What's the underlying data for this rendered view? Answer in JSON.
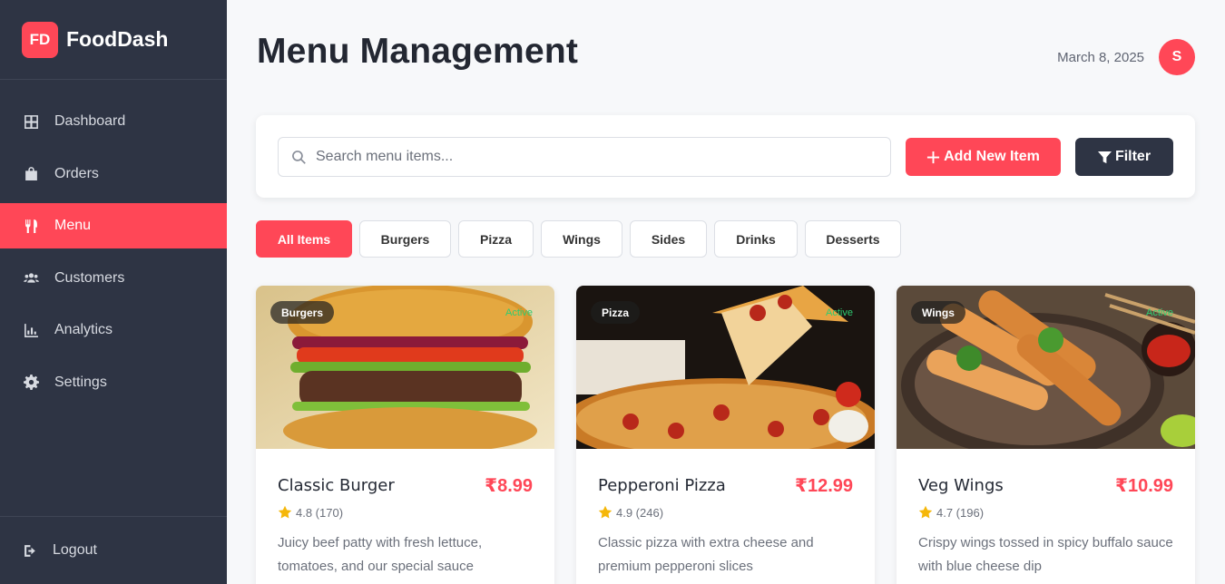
{
  "brand": {
    "logo": "FD",
    "name": "FoodDash"
  },
  "sidebar": {
    "items": [
      {
        "label": "Dashboard",
        "icon": "dashboard-icon"
      },
      {
        "label": "Orders",
        "icon": "bag-icon"
      },
      {
        "label": "Menu",
        "icon": "utensils-icon",
        "active": true
      },
      {
        "label": "Customers",
        "icon": "users-icon"
      },
      {
        "label": "Analytics",
        "icon": "chart-icon"
      },
      {
        "label": "Settings",
        "icon": "gear-icon"
      }
    ],
    "logout": "Logout"
  },
  "header": {
    "title": "Menu Management",
    "date": "March 8, 2025",
    "avatar": "S"
  },
  "toolbar": {
    "search_placeholder": "Search menu items...",
    "add_label": "Add New Item",
    "filter_label": "Filter"
  },
  "categories": [
    "All Items",
    "Burgers",
    "Pizza",
    "Wings",
    "Sides",
    "Drinks",
    "Desserts"
  ],
  "items": [
    {
      "tag": "Burgers",
      "status": "Active",
      "name": "Classic Burger",
      "price": "₹8.99",
      "rating": "4.8 (170)",
      "description": "Juicy beef patty with fresh lettuce, tomatoes, and our special sauce"
    },
    {
      "tag": "Pizza",
      "status": "Active",
      "name": "Pepperoni Pizza",
      "price": "₹12.99",
      "rating": "4.9 (246)",
      "description": "Classic pizza with extra cheese and premium pepperoni slices"
    },
    {
      "tag": "Wings",
      "status": "Active",
      "name": "Veg Wings",
      "price": "₹10.99",
      "rating": "4.7 (196)",
      "description": "Crispy wings tossed in spicy buffalo sauce with blue cheese dip"
    }
  ],
  "colors": {
    "accent": "#ff4757",
    "sidebar": "#2e3444",
    "status_active": "#2ecc71"
  }
}
